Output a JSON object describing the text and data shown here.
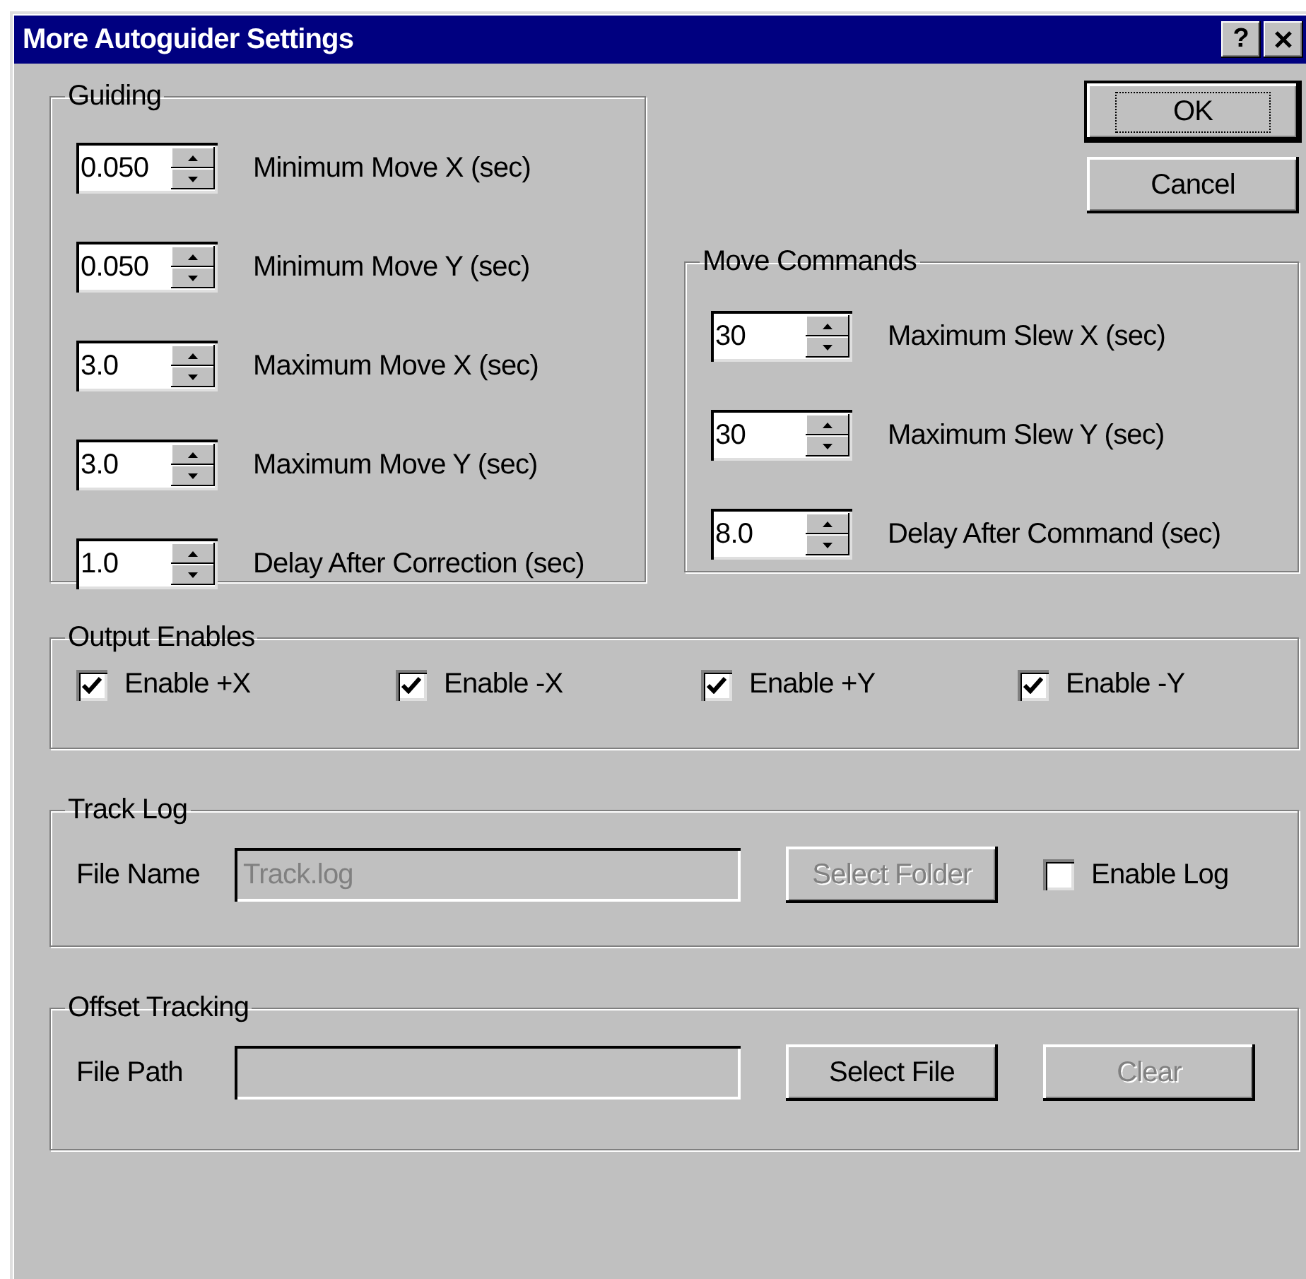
{
  "window": {
    "title": "More Autoguider Settings",
    "help_button": "?"
  },
  "buttons": [
    {
      "label": "OK",
      "default": true
    },
    {
      "label": "Cancel",
      "default": false
    }
  ],
  "guiding": {
    "title": "Guiding",
    "fields": [
      {
        "value": "0.050",
        "label": "Minimum Move X (sec)"
      },
      {
        "value": "0.050",
        "label": "Minimum Move Y (sec)"
      },
      {
        "value": "3.0",
        "label": "Maximum Move X (sec)"
      },
      {
        "value": "3.0",
        "label": "Maximum Move Y (sec)"
      },
      {
        "value": "1.0",
        "label": "Delay After Correction (sec)"
      }
    ]
  },
  "move_commands": {
    "title": "Move Commands",
    "fields": [
      {
        "value": "30",
        "label": "Maximum Slew X (sec)"
      },
      {
        "value": "30",
        "label": "Maximum Slew Y (sec)"
      },
      {
        "value": "8.0",
        "label": "Delay After Command (sec)"
      }
    ]
  },
  "output_enables": {
    "title": "Output Enables",
    "checkboxes": [
      {
        "label": "Enable +X",
        "checked": true
      },
      {
        "label": "Enable -X",
        "checked": true
      },
      {
        "label": "Enable +Y",
        "checked": true
      },
      {
        "label": "Enable -Y",
        "checked": true
      }
    ]
  },
  "track_log": {
    "title": "Track Log",
    "field_label": "File Name",
    "field_value": "Track.log",
    "field_disabled": true,
    "button": {
      "label": "Select Folder",
      "disabled": true
    },
    "checkbox": {
      "label": "Enable Log",
      "checked": false
    }
  },
  "offset_tracking": {
    "title": "Offset Tracking",
    "field_label": "File Path",
    "field_disabled": true,
    "buttons": [
      {
        "label": "Select File",
        "disabled": false
      },
      {
        "label": "Clear",
        "disabled": true
      }
    ]
  }
}
